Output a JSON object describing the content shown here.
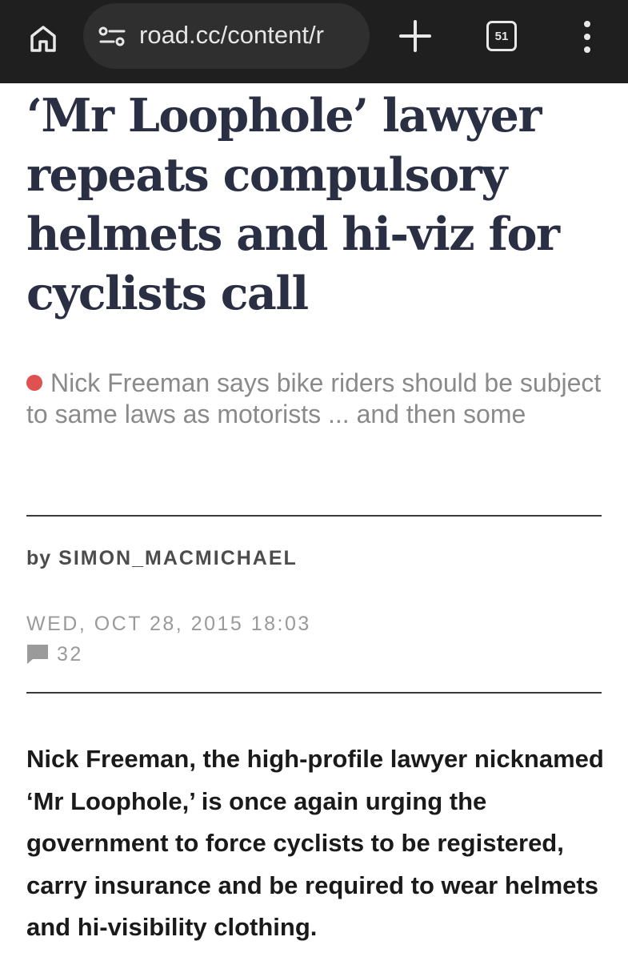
{
  "browser": {
    "url": "road.cc/content/r",
    "tab_count": "51",
    "icons": {
      "home": "home-icon",
      "site_settings": "tune-icon",
      "new_tab": "plus-icon",
      "tabs": "tab-switcher-icon",
      "menu": "more-vert-icon"
    },
    "colors": {
      "toolbar": "#1f1f1f",
      "url_pill": "#2f2f30"
    }
  },
  "article": {
    "headline": "‘Mr Loophole’ lawyer repeats compulsory helmets and hi-viz for cyclists call",
    "standfirst": "Nick Freeman says bike riders should be subject to same laws as motorists ... and then some",
    "byline_prefix": "by",
    "author": "SIMON_MACMICHAEL",
    "date": "WED, OCT 28, 2015 18:03",
    "comment_count": "32",
    "body": "Nick Freeman, the high-profile lawyer nicknamed ‘Mr Loophole,’ is once again urging the government to force cyclists to be registered, carry insurance and be required to wear helmets and hi-visibility clothing.",
    "colors": {
      "headline": "#2b2f44",
      "accent_dot": "#e05151",
      "standfirst": "#8a8a8a",
      "meta": "#9a9a9a"
    }
  }
}
